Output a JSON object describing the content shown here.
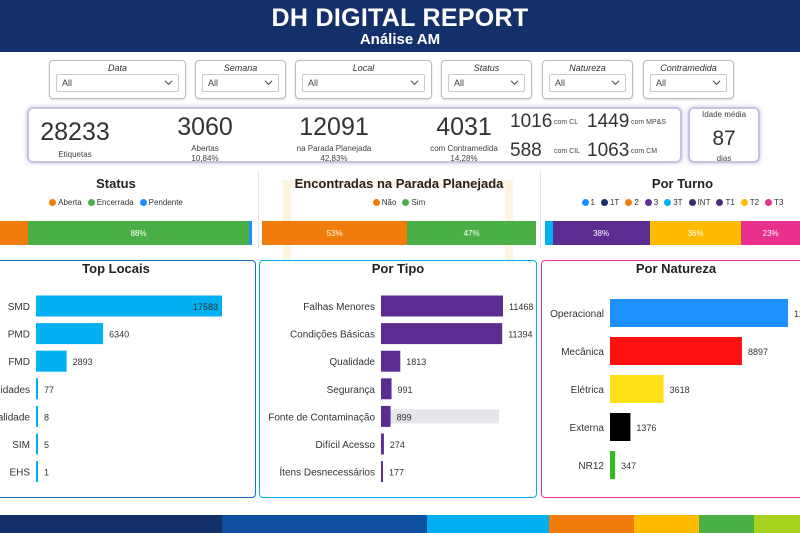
{
  "header": {
    "title": "DH DIGITAL REPORT",
    "subtitle": "Análise AM"
  },
  "filters": [
    {
      "label": "Data",
      "value": "All"
    },
    {
      "label": "Semana",
      "value": "All"
    },
    {
      "label": "Local",
      "value": "All"
    },
    {
      "label": "Status",
      "value": "All"
    },
    {
      "label": "Natureza",
      "value": "All"
    },
    {
      "label": "Contramedida",
      "value": "All"
    }
  ],
  "kpis": {
    "etiquetas": {
      "value": "28233",
      "label": "Etiquetas"
    },
    "abertas": {
      "value": "3060",
      "label": "Abertas",
      "pct": "10,84%"
    },
    "parada": {
      "value": "12091",
      "label": "na Parada Planejada",
      "pct": "42,83%"
    },
    "contramedida": {
      "value": "4031",
      "label": "com Contramedida",
      "pct": "14,28%"
    },
    "cl": {
      "value": "1016",
      "label": "com CL"
    },
    "mps": {
      "value": "1449",
      "label": "com MP&S"
    },
    "cil": {
      "value": "588",
      "label": "com CIL"
    },
    "cm": {
      "value": "1063",
      "label": "com CM"
    },
    "idade": {
      "label": "Idade média",
      "value": "87",
      "unit": "dias"
    }
  },
  "colors": {
    "header": "#14306b",
    "orange": "#f07d0b",
    "green": "#4aaf47",
    "blue": "#1e90ff",
    "cyan": "#00b0f0",
    "purple": "#5c2d91",
    "red": "#ff1010",
    "yellow": "#ffe11a",
    "black": "#000000",
    "lime": "#33bb22",
    "gold": "#ffbb00",
    "magenta": "#e8308c"
  },
  "chart_data": [
    {
      "type": "bar",
      "title": "Status",
      "stacked": true,
      "legend_position": "top",
      "series": [
        {
          "name": "Aberta",
          "value": 11,
          "color": "#f07d0b"
        },
        {
          "name": "Encerrada",
          "value": 88,
          "color": "#4aaf47",
          "label": "88%"
        },
        {
          "name": "Pendente",
          "value": 1,
          "color": "#1e90ff"
        }
      ]
    },
    {
      "type": "bar",
      "title": "Encontradas na Parada Planejada",
      "stacked": true,
      "legend_position": "top",
      "series": [
        {
          "name": "Não",
          "value": 53,
          "color": "#f07d0b",
          "label": "53%"
        },
        {
          "name": "Sim",
          "value": 47,
          "color": "#4aaf47",
          "label": "47%"
        }
      ]
    },
    {
      "type": "bar",
      "title": "Por Turno",
      "stacked": true,
      "legend_position": "top",
      "legend": [
        {
          "name": "1",
          "color": "#1e90ff"
        },
        {
          "name": "1T",
          "color": "#14306b"
        },
        {
          "name": "2",
          "color": "#f07d0b"
        },
        {
          "name": "3",
          "color": "#5c2d91"
        },
        {
          "name": "3T",
          "color": "#00b0f0"
        },
        {
          "name": "INT",
          "color": "#3a2d6b"
        },
        {
          "name": "T1",
          "color": "#4b2c7a"
        },
        {
          "name": "T2",
          "color": "#ffbb00"
        },
        {
          "name": "T3",
          "color": "#e8308c"
        }
      ],
      "series": [
        {
          "name": "3T",
          "value": 3,
          "color": "#00b0f0"
        },
        {
          "name": "T1",
          "value": 38,
          "color": "#5c2d91",
          "label": "38%"
        },
        {
          "name": "T2",
          "value": 36,
          "color": "#ffbb00",
          "label": "36%"
        },
        {
          "name": "T3",
          "value": 23,
          "color": "#e8308c",
          "label": "23%"
        }
      ]
    },
    {
      "type": "bar",
      "orientation": "horizontal",
      "title": "Top Locais",
      "color": "#00b0f0",
      "xlim": [
        0,
        17583
      ],
      "categories": [
        "SMD",
        "PMD",
        "FMD",
        "idades",
        "alidade",
        "SIM",
        "EHS"
      ],
      "values": [
        17583,
        6340,
        2893,
        77,
        8,
        5,
        1
      ]
    },
    {
      "type": "bar",
      "orientation": "horizontal",
      "title": "Por Tipo",
      "color": "#5c2d91",
      "xlim": [
        0,
        11468
      ],
      "categories": [
        "Falhas Menores",
        "Condições Básicas",
        "Qualidade",
        "Segurança",
        "Fonte de Contaminação",
        "Difícil Acesso",
        "Ítens Desnecessários"
      ],
      "values": [
        11468,
        11394,
        1813,
        991,
        899,
        274,
        177
      ]
    },
    {
      "type": "bar",
      "orientation": "horizontal",
      "title": "Por Natureza",
      "xlim": [
        0,
        12000
      ],
      "categories": [
        "Operacional",
        "Mecânica",
        "Elétrica",
        "Externa",
        "NR12"
      ],
      "values": [
        12000,
        8897,
        3618,
        1376,
        347
      ],
      "value_labels": [
        "12",
        "8897",
        "3618",
        "1376",
        "347"
      ],
      "colors": [
        "#1e90ff",
        "#ff1010",
        "#ffe11a",
        "#000000",
        "#33bb22"
      ]
    }
  ],
  "bottom_strip": [
    "#14306b",
    "#0f4fa0",
    "#00b0f0",
    "#f07d0b",
    "#ffbb00",
    "#4aaf47",
    "#a6d11f"
  ]
}
